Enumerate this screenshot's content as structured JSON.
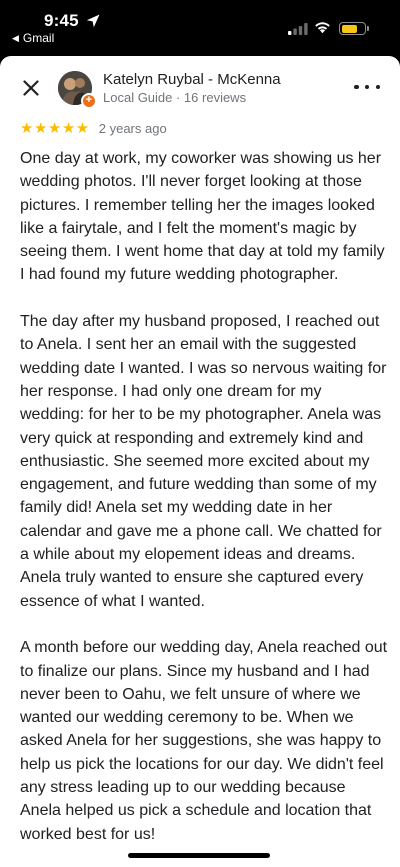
{
  "status_bar": {
    "time": "9:45",
    "back_app_label": "Gmail"
  },
  "reviewer": {
    "name": "Katelyn Ruybal - McKenna",
    "meta": "Local Guide · 16 reviews"
  },
  "review": {
    "rating": 5,
    "stars_text": "★★★★★",
    "date": "2 years ago",
    "paragraphs": [
      "One day at work, my coworker was showing us her wedding photos. I'll never forget looking at those pictures. I remember telling her the images looked like a fairytale, and I felt the moment's magic by seeing them. I went home that day at told my family I had found my future wedding photographer.",
      "The day after my husband proposed, I reached out to Anela. I sent her an email with the suggested wedding date I wanted. I was so nervous waiting for her response. I had only one dream for my wedding: for her to be my photographer. Anela was very quick at responding and extremely kind and enthusiastic. She seemed more excited about my engagement, and future wedding than some of my family did! Anela set my wedding date in her calendar and gave me a phone call. We chatted for a while about my elopement ideas and dreams. Anela truly wanted to ensure she captured every essence of what I wanted.",
      "A month before our wedding day, Anela reached out to finalize our plans. Since my husband and I had never been to Oahu, we felt unsure of where we wanted our wedding ceremony to be. When we asked Anela for her suggestions, she was happy to help us pick the locations for our day. We didn't feel any stress leading up to our wedding because Anela helped us pick a schedule and location that worked best for us!"
    ]
  },
  "colors": {
    "star": "#fbbc04",
    "badge": "#e8711a",
    "battery": "#f5c518"
  },
  "icons": {
    "close": "close-icon",
    "more": "more-vert-icon",
    "location": "location-arrow-icon",
    "signal": "cellular-signal-icon",
    "wifi": "wifi-icon",
    "battery": "battery-icon"
  }
}
